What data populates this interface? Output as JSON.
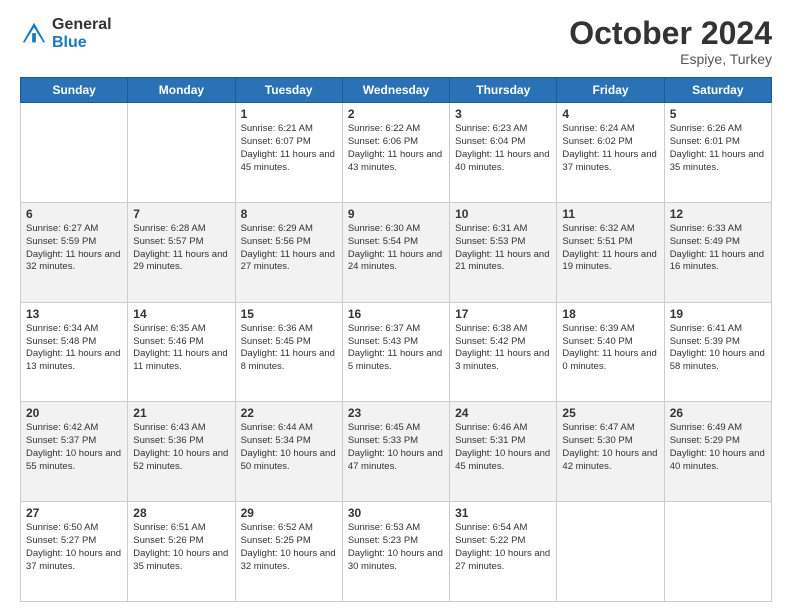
{
  "logo": {
    "general": "General",
    "blue": "Blue"
  },
  "header": {
    "month": "October 2024",
    "location": "Espiye, Turkey"
  },
  "weekdays": [
    "Sunday",
    "Monday",
    "Tuesday",
    "Wednesday",
    "Thursday",
    "Friday",
    "Saturday"
  ],
  "weeks": [
    [
      {
        "day": "",
        "content": ""
      },
      {
        "day": "",
        "content": ""
      },
      {
        "day": "1",
        "content": "Sunrise: 6:21 AM\nSunset: 6:07 PM\nDaylight: 11 hours and 45 minutes."
      },
      {
        "day": "2",
        "content": "Sunrise: 6:22 AM\nSunset: 6:06 PM\nDaylight: 11 hours and 43 minutes."
      },
      {
        "day": "3",
        "content": "Sunrise: 6:23 AM\nSunset: 6:04 PM\nDaylight: 11 hours and 40 minutes."
      },
      {
        "day": "4",
        "content": "Sunrise: 6:24 AM\nSunset: 6:02 PM\nDaylight: 11 hours and 37 minutes."
      },
      {
        "day": "5",
        "content": "Sunrise: 6:26 AM\nSunset: 6:01 PM\nDaylight: 11 hours and 35 minutes."
      }
    ],
    [
      {
        "day": "6",
        "content": "Sunrise: 6:27 AM\nSunset: 5:59 PM\nDaylight: 11 hours and 32 minutes."
      },
      {
        "day": "7",
        "content": "Sunrise: 6:28 AM\nSunset: 5:57 PM\nDaylight: 11 hours and 29 minutes."
      },
      {
        "day": "8",
        "content": "Sunrise: 6:29 AM\nSunset: 5:56 PM\nDaylight: 11 hours and 27 minutes."
      },
      {
        "day": "9",
        "content": "Sunrise: 6:30 AM\nSunset: 5:54 PM\nDaylight: 11 hours and 24 minutes."
      },
      {
        "day": "10",
        "content": "Sunrise: 6:31 AM\nSunset: 5:53 PM\nDaylight: 11 hours and 21 minutes."
      },
      {
        "day": "11",
        "content": "Sunrise: 6:32 AM\nSunset: 5:51 PM\nDaylight: 11 hours and 19 minutes."
      },
      {
        "day": "12",
        "content": "Sunrise: 6:33 AM\nSunset: 5:49 PM\nDaylight: 11 hours and 16 minutes."
      }
    ],
    [
      {
        "day": "13",
        "content": "Sunrise: 6:34 AM\nSunset: 5:48 PM\nDaylight: 11 hours and 13 minutes."
      },
      {
        "day": "14",
        "content": "Sunrise: 6:35 AM\nSunset: 5:46 PM\nDaylight: 11 hours and 11 minutes."
      },
      {
        "day": "15",
        "content": "Sunrise: 6:36 AM\nSunset: 5:45 PM\nDaylight: 11 hours and 8 minutes."
      },
      {
        "day": "16",
        "content": "Sunrise: 6:37 AM\nSunset: 5:43 PM\nDaylight: 11 hours and 5 minutes."
      },
      {
        "day": "17",
        "content": "Sunrise: 6:38 AM\nSunset: 5:42 PM\nDaylight: 11 hours and 3 minutes."
      },
      {
        "day": "18",
        "content": "Sunrise: 6:39 AM\nSunset: 5:40 PM\nDaylight: 11 hours and 0 minutes."
      },
      {
        "day": "19",
        "content": "Sunrise: 6:41 AM\nSunset: 5:39 PM\nDaylight: 10 hours and 58 minutes."
      }
    ],
    [
      {
        "day": "20",
        "content": "Sunrise: 6:42 AM\nSunset: 5:37 PM\nDaylight: 10 hours and 55 minutes."
      },
      {
        "day": "21",
        "content": "Sunrise: 6:43 AM\nSunset: 5:36 PM\nDaylight: 10 hours and 52 minutes."
      },
      {
        "day": "22",
        "content": "Sunrise: 6:44 AM\nSunset: 5:34 PM\nDaylight: 10 hours and 50 minutes."
      },
      {
        "day": "23",
        "content": "Sunrise: 6:45 AM\nSunset: 5:33 PM\nDaylight: 10 hours and 47 minutes."
      },
      {
        "day": "24",
        "content": "Sunrise: 6:46 AM\nSunset: 5:31 PM\nDaylight: 10 hours and 45 minutes."
      },
      {
        "day": "25",
        "content": "Sunrise: 6:47 AM\nSunset: 5:30 PM\nDaylight: 10 hours and 42 minutes."
      },
      {
        "day": "26",
        "content": "Sunrise: 6:49 AM\nSunset: 5:29 PM\nDaylight: 10 hours and 40 minutes."
      }
    ],
    [
      {
        "day": "27",
        "content": "Sunrise: 6:50 AM\nSunset: 5:27 PM\nDaylight: 10 hours and 37 minutes."
      },
      {
        "day": "28",
        "content": "Sunrise: 6:51 AM\nSunset: 5:26 PM\nDaylight: 10 hours and 35 minutes."
      },
      {
        "day": "29",
        "content": "Sunrise: 6:52 AM\nSunset: 5:25 PM\nDaylight: 10 hours and 32 minutes."
      },
      {
        "day": "30",
        "content": "Sunrise: 6:53 AM\nSunset: 5:23 PM\nDaylight: 10 hours and 30 minutes."
      },
      {
        "day": "31",
        "content": "Sunrise: 6:54 AM\nSunset: 5:22 PM\nDaylight: 10 hours and 27 minutes."
      },
      {
        "day": "",
        "content": ""
      },
      {
        "day": "",
        "content": ""
      }
    ]
  ]
}
